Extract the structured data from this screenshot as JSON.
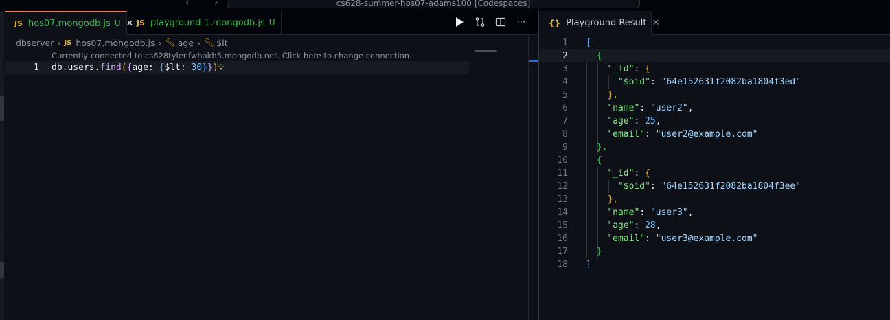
{
  "window": {
    "command_center": "cs628-summer-hos07-adams100 [Codespaces]"
  },
  "left_editor": {
    "tabs": [
      {
        "badge": "JS",
        "name": "hos07.mongodb.js",
        "status": "U",
        "active": true
      },
      {
        "badge": "JS",
        "name": "playground-1.mongodb.js",
        "status": "U",
        "active": false
      }
    ],
    "breadcrumb": {
      "root": "dbserver",
      "file_badge": "JS",
      "file": "hos07.mongodb.js",
      "symbol1": "age",
      "symbol2": "$lt"
    },
    "codelens": "Currently connected to cs628tyler.fwhakh5.mongodb.net. Click here to change connection.",
    "line_number": "1",
    "code": {
      "obj": "db",
      "dot1": ".",
      "coll": "users",
      "dot2": ".",
      "method": "find",
      "p_open": "(",
      "b_open": "{",
      "key": "age: ",
      "b2_open": "{",
      "op": "$lt: ",
      "value": "30",
      "b2_close": "}",
      "b_close": "}",
      "p_close": ")"
    }
  },
  "right_editor": {
    "tab": {
      "icon": "{}",
      "name": "Playground Result"
    },
    "current_line": 2,
    "lines": [
      {
        "n": "1"
      },
      {
        "n": "2"
      },
      {
        "n": "3"
      },
      {
        "n": "4"
      },
      {
        "n": "5"
      },
      {
        "n": "6"
      },
      {
        "n": "7"
      },
      {
        "n": "8"
      },
      {
        "n": "9"
      },
      {
        "n": "10"
      },
      {
        "n": "11"
      },
      {
        "n": "12"
      },
      {
        "n": "13"
      },
      {
        "n": "14"
      },
      {
        "n": "15"
      },
      {
        "n": "16"
      },
      {
        "n": "17"
      },
      {
        "n": "18"
      }
    ],
    "documents": [
      {
        "oid": "64e152631f2082ba1804f3ed",
        "name": "user2",
        "age": "25",
        "email": "user2@example.com"
      },
      {
        "oid": "64e152631f2082ba1804f3ee",
        "name": "user3",
        "age": "28",
        "email": "user3@example.com"
      }
    ],
    "keys": {
      "id": "\"_id\"",
      "oid": "\"$oid\"",
      "name": "\"name\"",
      "age": "\"age\"",
      "email": "\"email\""
    }
  }
}
